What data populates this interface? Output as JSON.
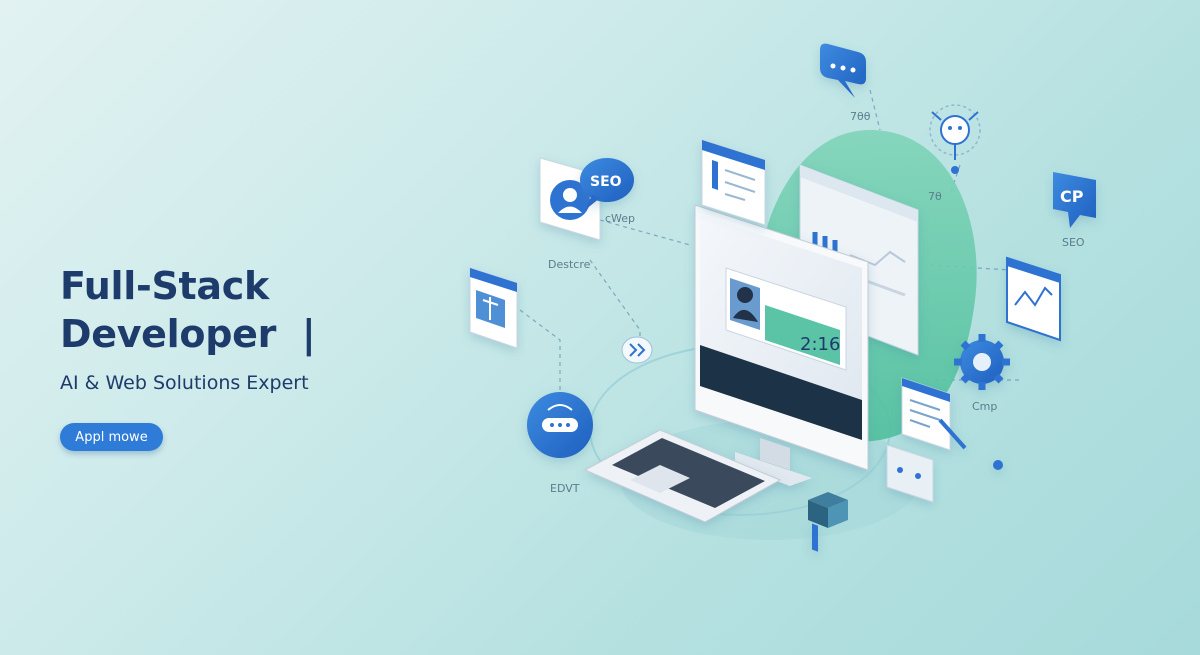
{
  "hero": {
    "headline_line1": "Full-Stack",
    "headline_line2": "Developer  |",
    "subheadline": "AI & Web Solutions Expert",
    "cta_label": "Appl mowe"
  },
  "illustration": {
    "labels": {
      "seo_bubble": "SEO",
      "cp_bubble": "CP",
      "clock_time": "2:16",
      "seo_side": "SEO",
      "cmp": "Cmp",
      "val_top": "7θθ",
      "val_mid": "7θ",
      "cwep": "cWep",
      "desktop": "Destcre",
      "edit": "EDVT"
    },
    "icons": [
      "chat-bubble-icon",
      "seo-bubble-icon",
      "avatar-card-icon",
      "web-window-icon",
      "bug-network-icon",
      "cp-bubble-icon",
      "line-chart-icon",
      "gear-icon",
      "chevron-double-right-icon",
      "router-badge-icon",
      "monitor-icon",
      "laptop-icon",
      "document-icon",
      "cube-icon",
      "chat-dots-icon"
    ]
  },
  "colors": {
    "background": "#cdeaea",
    "headline": "#1d3b6b",
    "accent_blue": "#2f72d2",
    "accent_green": "#5cc4a6",
    "cta": "#2f7bd8"
  }
}
